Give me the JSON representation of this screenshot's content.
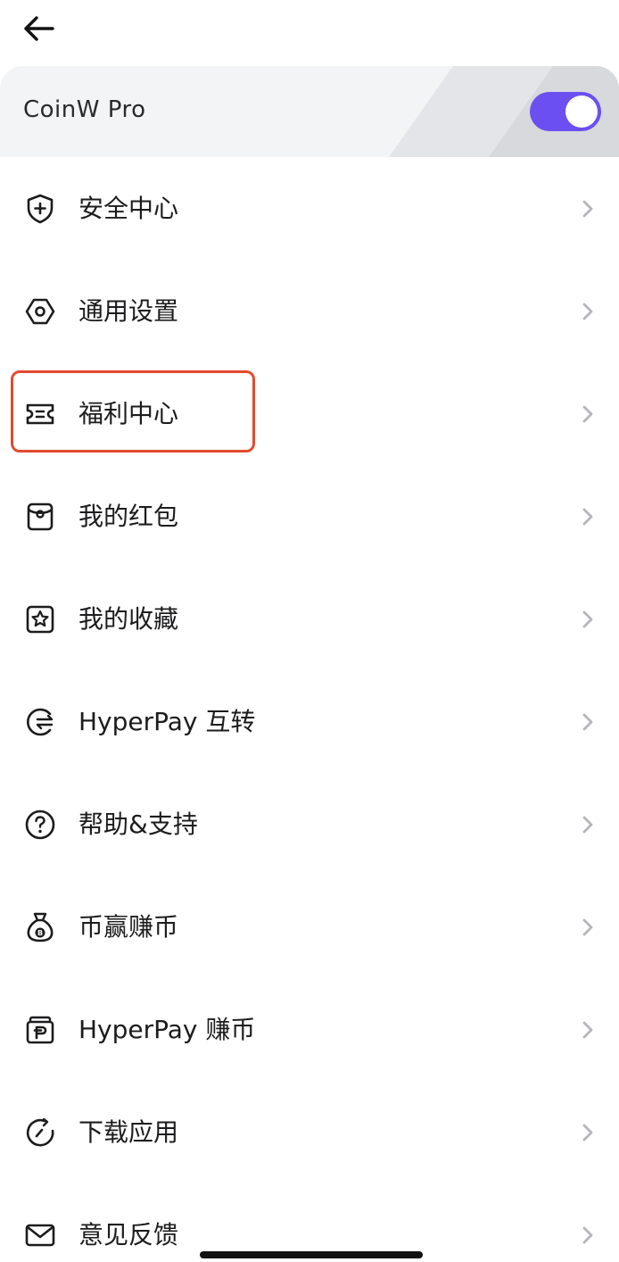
{
  "header": {
    "back_icon": "arrow-left-icon"
  },
  "pro_card": {
    "title": "CoinW Pro",
    "toggle_on": true,
    "toggle_color": "#6c4ff0"
  },
  "menu": {
    "items": [
      {
        "id": "security",
        "label": "安全中心",
        "icon": "shield-plus-icon"
      },
      {
        "id": "general-settings",
        "label": "通用设置",
        "icon": "hexagon-gear-icon"
      },
      {
        "id": "welfare",
        "label": "福利中心",
        "icon": "ticket-icon",
        "highlighted": true
      },
      {
        "id": "red-packet",
        "label": "我的红包",
        "icon": "red-envelope-icon"
      },
      {
        "id": "favorites",
        "label": "我的收藏",
        "icon": "star-box-icon"
      },
      {
        "id": "hyperpay-transfer",
        "label": "HyperPay 互转",
        "icon": "transfer-arrows-icon"
      },
      {
        "id": "help",
        "label": "帮助&支持",
        "icon": "question-circle-icon"
      },
      {
        "id": "earn",
        "label": "币赢赚币",
        "icon": "money-bag-icon"
      },
      {
        "id": "hyperpay-earn",
        "label": "HyperPay 赚币",
        "icon": "wallet-p-icon"
      },
      {
        "id": "download",
        "label": "下载应用",
        "icon": "refresh-circle-icon"
      },
      {
        "id": "feedback",
        "label": "意见反馈",
        "icon": "envelope-icon"
      }
    ]
  },
  "colors": {
    "highlight": "#e24b2f",
    "accent": "#6c4ff0",
    "chevron": "#b5b5ba"
  }
}
